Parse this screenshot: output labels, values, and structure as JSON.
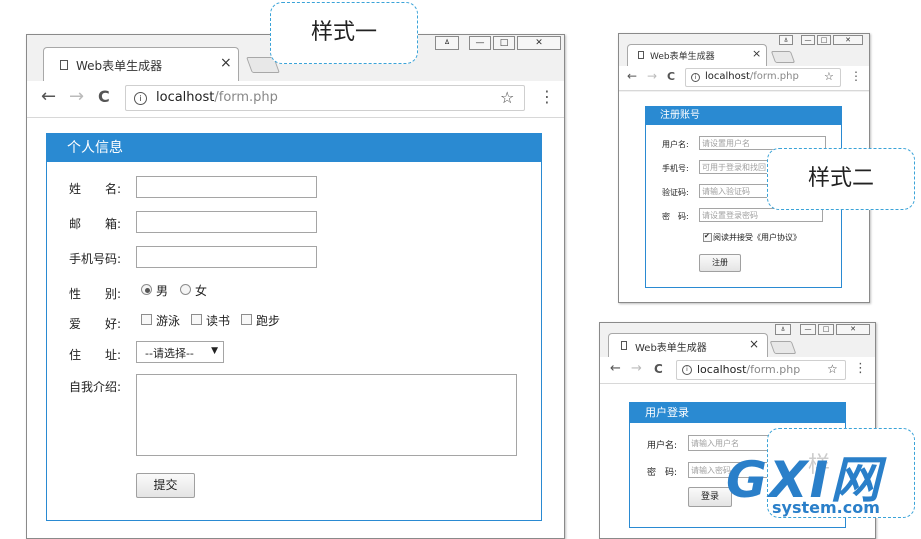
{
  "callouts": {
    "style1": "样式一",
    "style2": "样式二",
    "style3": "样"
  },
  "browser": {
    "tab_title": "Web表单生成器",
    "close_glyph": "×",
    "url_host": "localhost",
    "url_path": "/form.php",
    "info_glyph": "i",
    "back_glyph": "←",
    "forward_glyph": "→",
    "reload_glyph": "C",
    "star_glyph": "☆",
    "menu_glyph": "⋮",
    "win_user": "ㅿ",
    "win_min": "—",
    "win_max": "□",
    "win_close": "✕"
  },
  "form1": {
    "header": "个人信息",
    "name_label": "姓　　名:",
    "email_label": "邮　　箱:",
    "phone_label": "手机号码:",
    "gender_label": "性　　别:",
    "gender_options": [
      "男",
      "女"
    ],
    "gender_selected": "男",
    "hobby_label": "爱　　好:",
    "hobby_options": [
      "游泳",
      "读书",
      "跑步"
    ],
    "address_label": "住　　址:",
    "address_selected": "--请选择--",
    "select_arrow": "▼",
    "intro_label": "自我介绍:",
    "submit": "提交"
  },
  "form2": {
    "header": "注册账号",
    "username_label": "用户名:",
    "username_placeholder": "请设置用户名",
    "phone_label": "手机号:",
    "phone_placeholder": "可用于登录和找回",
    "code_label": "验证码:",
    "code_placeholder": "请输入验证码",
    "password_label": "密　码:",
    "password_placeholder": "请设置登录密码",
    "agree_text": "阅读并接受《用户协议》",
    "agree_checked": true,
    "check_glyph": "✔",
    "submit": "注册"
  },
  "form3": {
    "header": "用户登录",
    "username_label": "用户名:",
    "username_placeholder": "请输入用户名",
    "password_label": "密　码:",
    "password_placeholder": "请输入密码",
    "submit": "登录"
  },
  "watermark": {
    "brand": "GXI网",
    "domain": "system.com"
  }
}
